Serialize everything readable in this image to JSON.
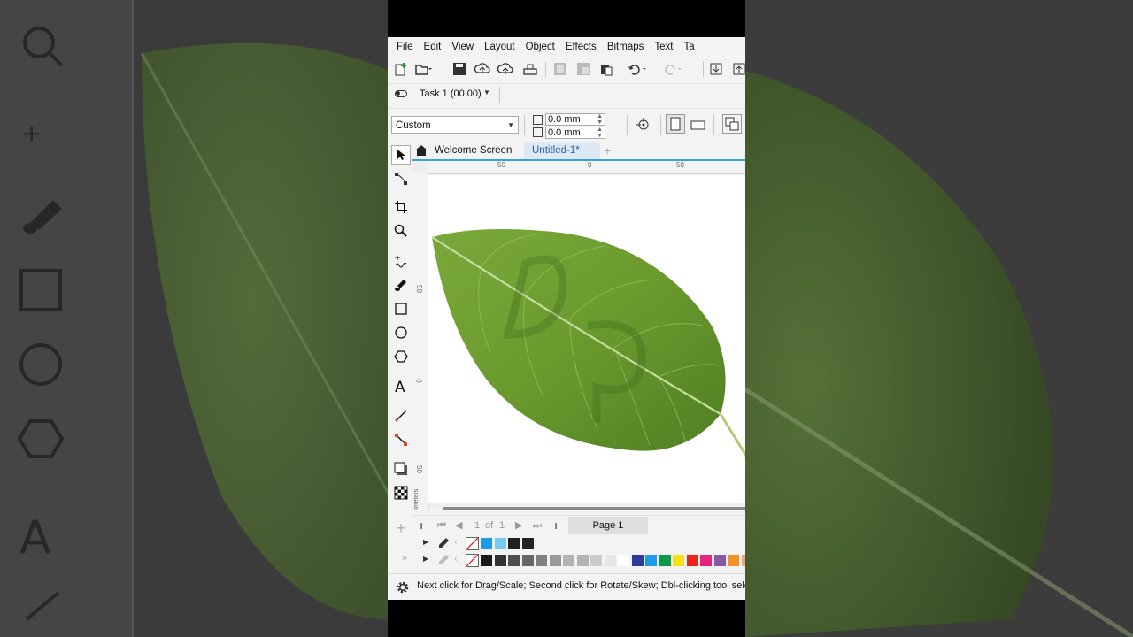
{
  "menu": [
    "File",
    "Edit",
    "View",
    "Layout",
    "Object",
    "Effects",
    "Bitmaps",
    "Text",
    "Ta"
  ],
  "task": {
    "label": "Task 1 (00:00)"
  },
  "propbar": {
    "preset": "Custom",
    "nudge_1": "0.0 mm",
    "nudge_2": "0.0 mm"
  },
  "tabs": {
    "welcome": "Welcome Screen",
    "document": "Untitled-1*",
    "add": "+"
  },
  "rulers": {
    "h_ticks": [
      "50",
      "0",
      "50"
    ],
    "v_ticks": [
      "50",
      "0",
      "50"
    ],
    "unit": "millimeters"
  },
  "pagenav": {
    "add_before": "+",
    "current": "1",
    "of_label": "of",
    "total": "1",
    "add_after": "+",
    "page_tab": "Page 1"
  },
  "palette_doc": [
    "#1e9be8",
    "#7cc8f4",
    "#222222",
    "#222222"
  ],
  "palette_default": [
    "#1a1a1a",
    "#333333",
    "#4d4d4d",
    "#666666",
    "#808080",
    "#999999",
    "#b3b3b3",
    "#b3b3b3",
    "#cccccc",
    "#e6e6e6",
    "#ffffff",
    "#2b3a9b",
    "#1e9be8",
    "#0a9a4a",
    "#f7e11b",
    "#e8261e",
    "#e8257d",
    "#8a57a5",
    "#f39021",
    "#f5a27a"
  ],
  "status": {
    "text": "Next click for Drag/Scale; Second click for Rotate/Skew; Dbl-clicking tool sele"
  },
  "colors": {
    "accent": "#3aa0e6",
    "leaf": "#6a9a2e",
    "background_side": "#3d3d3d"
  },
  "artwork": {
    "watermark_text": "Dp"
  }
}
